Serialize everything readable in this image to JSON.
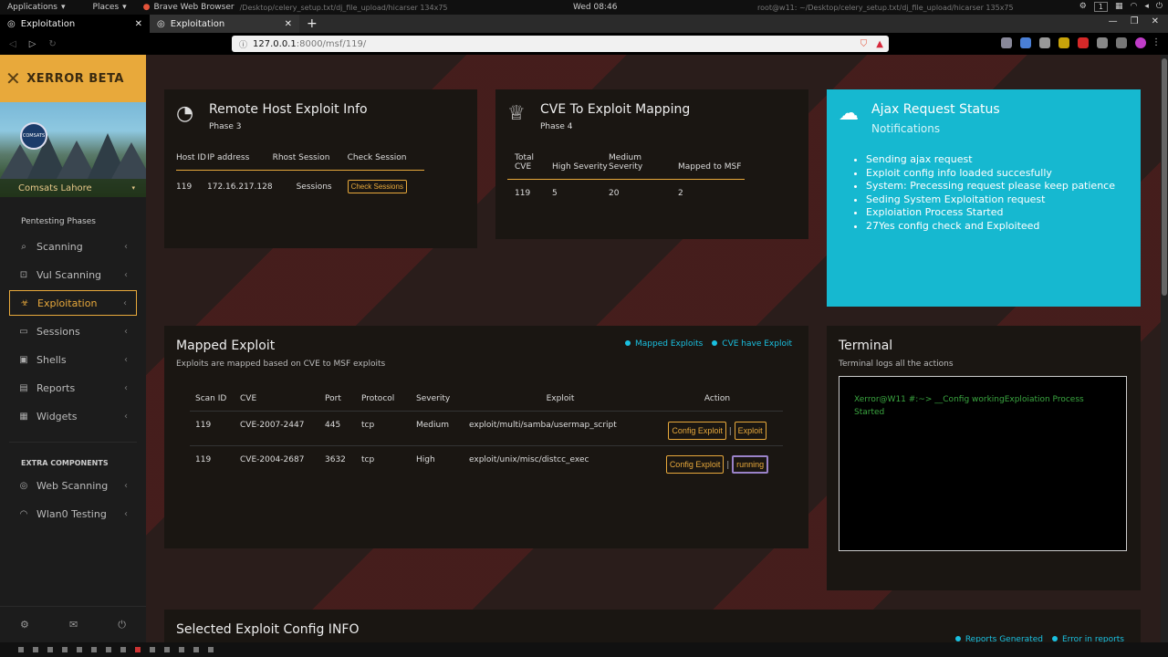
{
  "system": {
    "applications": "Applications",
    "places": "Places",
    "browser": "Brave Web Browser",
    "term_left": "/Desktop/celery_setup.txt/dj_file_upload/hicarser 134x75",
    "clock": "Wed 08:46",
    "term_right": "root@w11: ~/Desktop/celery_setup.txt/dj_file_upload/hicarser 135x75",
    "workspace": "1"
  },
  "tabs": [
    {
      "label": "Exploitation"
    },
    {
      "label": "Exploitation"
    }
  ],
  "address": {
    "host": "127.0.0.1",
    "path": ":8000/msf/119/"
  },
  "brand": {
    "name": "XERROR BETA"
  },
  "profile": {
    "location": "Comsats Lahore",
    "seal": "COMSATS"
  },
  "sidebar": {
    "heading": "Pentesting Phases",
    "items": [
      {
        "label": "Scanning"
      },
      {
        "label": "Vul Scanning"
      },
      {
        "label": "Exploitation"
      },
      {
        "label": "Sessions"
      },
      {
        "label": "Shells"
      },
      {
        "label": "Reports"
      },
      {
        "label": "Widgets"
      }
    ],
    "extra_heading": "EXTRA COMPONENTS",
    "extra_items": [
      {
        "label": "Web Scanning"
      },
      {
        "label": "Wlan0 Testing"
      }
    ]
  },
  "remote": {
    "title": "Remote Host Exploit Info",
    "phase": "Phase 3",
    "headers": [
      "Host ID",
      "IP address",
      "Rhost Session",
      "Check Session"
    ],
    "row": {
      "host_id": "119",
      "ip": "172.16.217.128",
      "session": "Sessions",
      "button": "Check Sessions"
    }
  },
  "cve": {
    "title": "CVE To Exploit Mapping",
    "phase": "Phase 4",
    "headers": [
      "Total CVE",
      "High Severity",
      "Medium Severity",
      "Mapped to MSF"
    ],
    "row": [
      "119",
      "5",
      "20",
      "2"
    ]
  },
  "ajax": {
    "title": "Ajax Request Status",
    "subtitle": "Notifications",
    "messages": [
      "Sending ajax request",
      "Exploit config info loaded succesfully",
      "System: Precessing request please keep patience",
      "Seding System Exploitation request",
      "Exploiation Process Started",
      "27Yes config check and Exploiteed"
    ]
  },
  "mapped": {
    "title": "Mapped Exploit",
    "subtitle": "Exploits are mapped based on CVE to MSF exploits",
    "legend": [
      "Mapped Exploits",
      "CVE have Exploit"
    ],
    "headers": [
      "Scan ID",
      "CVE",
      "Port",
      "Protocol",
      "Severity",
      "Exploit",
      "Action"
    ],
    "rows": [
      {
        "scan_id": "119",
        "cve": "CVE-2007-2447",
        "port": "445",
        "protocol": "tcp",
        "severity": "Medium",
        "exploit": "exploit/multi/samba/usermap_script",
        "config": "Config Exploit",
        "action": "Exploit"
      },
      {
        "scan_id": "119",
        "cve": "CVE-2004-2687",
        "port": "3632",
        "protocol": "tcp",
        "severity": "High",
        "exploit": "exploit/unix/misc/distcc_exec",
        "config": "Config Exploit",
        "action": "running"
      }
    ]
  },
  "terminal": {
    "title": "Terminal",
    "subtitle": "Terminal logs all the actions",
    "log": "Xerror@W11 #:~> __Config workingExploiation Process Started"
  },
  "selected": {
    "title": "Selected Exploit Config INFO",
    "legend": [
      "Reports Generated",
      "Error in reports"
    ]
  },
  "colors": {
    "accent": "#e8a93b",
    "cyan": "#16b8d0",
    "terminal_green": "#3aa640"
  }
}
